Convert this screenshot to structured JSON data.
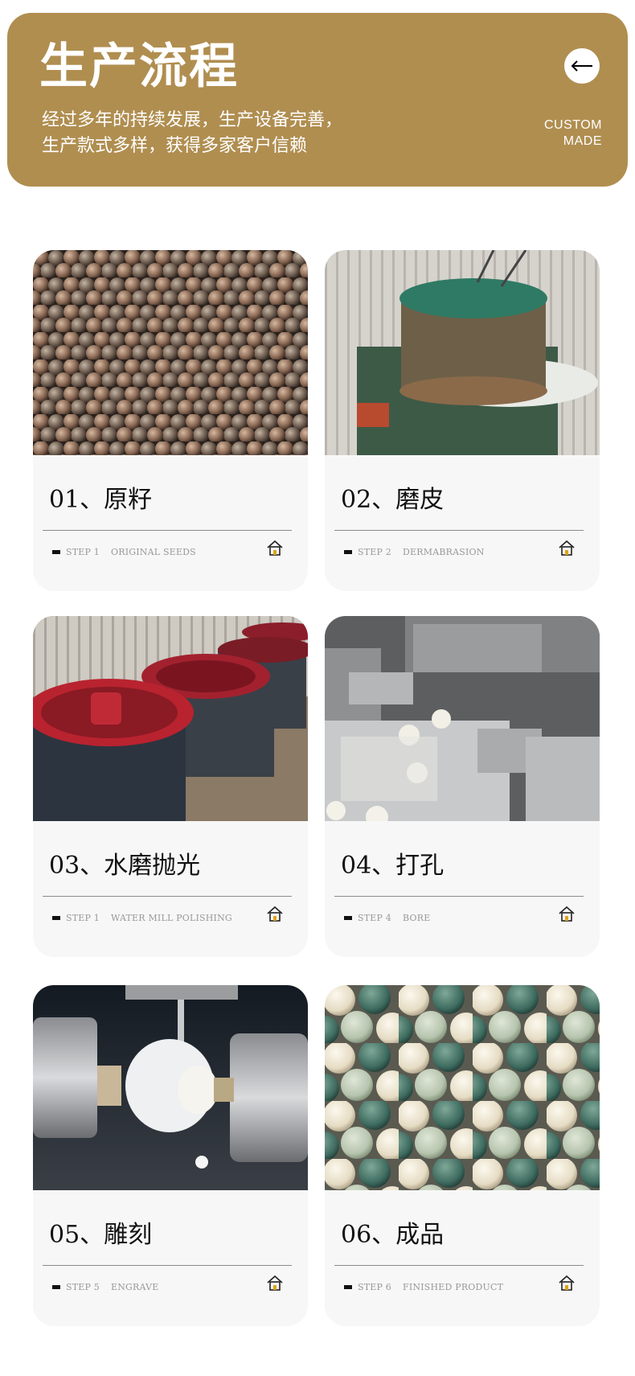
{
  "header": {
    "title": "生产流程",
    "subtitle_line1": "经过多年的持续发展，生产设备完善，",
    "subtitle_line2": "生产款式多样，获得多家客户信赖",
    "custom_line1": "CUSTOM",
    "custom_line2": "MADE",
    "back_icon": "arrow-left-icon",
    "accent_color": "#b08e50"
  },
  "steps": [
    {
      "title": "01、原籽",
      "step": "STEP 1",
      "caption": "ORIGINAL SEEDS",
      "photo": "seeds-photo"
    },
    {
      "title": "02、磨皮",
      "step": "STEP 2",
      "caption": "DERMABRASION",
      "photo": "grinder-photo"
    },
    {
      "title": "03、水磨抛光",
      "step": "STEP 1",
      "caption": "WATER MILL POLISHING",
      "photo": "polisher-photo"
    },
    {
      "title": "04、打孔",
      "step": "STEP 4",
      "caption": "BORE",
      "photo": "drill-photo"
    },
    {
      "title": "05、雕刻",
      "step": "STEP 5",
      "caption": "ENGRAVE",
      "photo": "engrave-photo"
    },
    {
      "title": "06、成品",
      "step": "STEP 6",
      "caption": "FINISHED PRODUCT",
      "photo": "beads-photo"
    }
  ]
}
